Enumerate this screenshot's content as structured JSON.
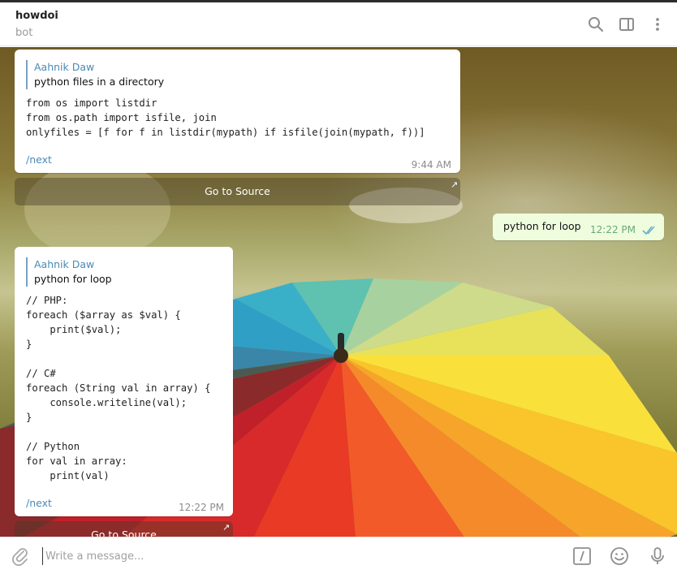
{
  "header": {
    "title": "howdoi",
    "subtitle": "bot",
    "icons": [
      "search-icon",
      "sidebar-toggle-icon",
      "more-vertical-icon"
    ]
  },
  "messages": [
    {
      "reply_name": "Aahnik Daw",
      "reply_text": "python files in a directory",
      "code": "from os import listdir\nfrom os.path import isfile, join\nonlyfiles = [f for f in listdir(mypath) if isfile(join(mypath, f))]",
      "command": "/next",
      "time": "9:44 AM",
      "button": "Go to Source"
    },
    {
      "text": "python for loop",
      "time": "12:22 PM",
      "status_icon": "double-check-icon"
    },
    {
      "reply_name": "Aahnik Daw",
      "reply_text": "python for loop",
      "code": "// PHP:\nforeach ($array as $val) {\n    print($val);\n}\n\n// C#\nforeach (String val in array) {\n    console.writeline(val);\n}\n\n// Python\nfor val in array:\n    print(val)",
      "command": "/next",
      "time": "12:22 PM",
      "button": "Go to Source"
    }
  ],
  "composer": {
    "placeholder": "Write a message...",
    "icons": [
      "attach-icon",
      "bot-command-icon",
      "emoji-icon",
      "microphone-icon"
    ]
  },
  "colors": {
    "link": "#4a8ab5",
    "outgoing_bubble": "#effdde",
    "read_check": "#6cb0c8"
  }
}
